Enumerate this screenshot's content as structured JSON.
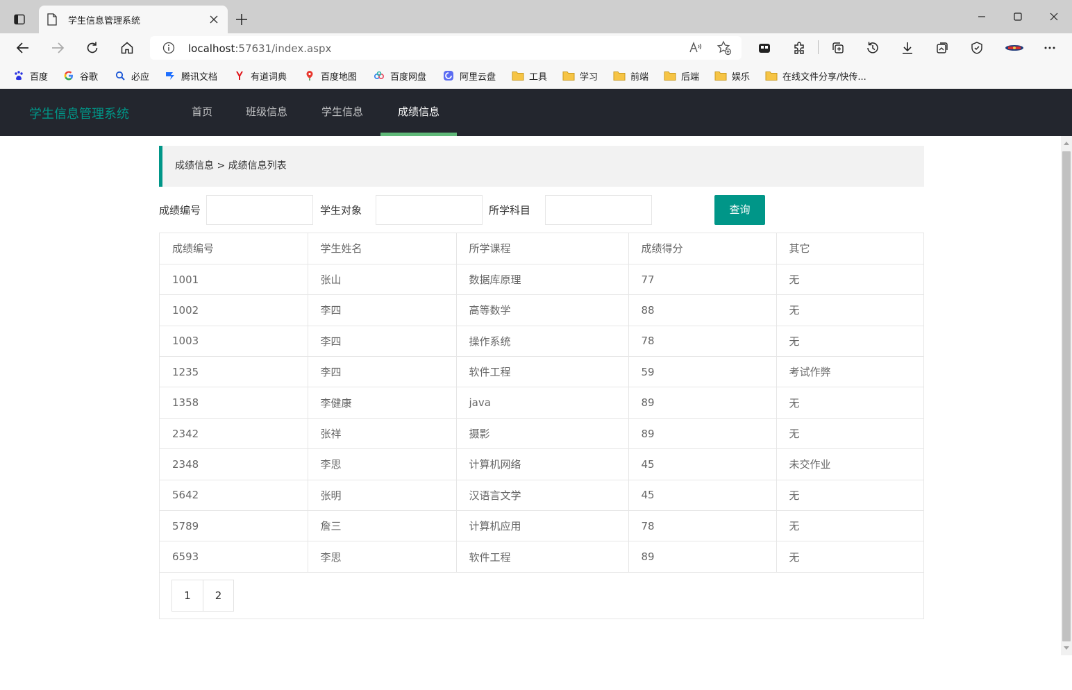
{
  "browser": {
    "tab_title": "学生信息管理系统",
    "url_host": "localhost",
    "url_rest": ":57631/index.aspx",
    "bookmarks": [
      {
        "label": "百度",
        "icon": "baidu-icon"
      },
      {
        "label": "谷歌",
        "icon": "google-icon"
      },
      {
        "label": "必应",
        "icon": "bing-icon"
      },
      {
        "label": "腾讯文档",
        "icon": "tencent-docs-icon"
      },
      {
        "label": "有道词典",
        "icon": "youdao-icon"
      },
      {
        "label": "百度地图",
        "icon": "map-pin-icon"
      },
      {
        "label": "百度网盘",
        "icon": "cloud-disk-icon"
      },
      {
        "label": "阿里云盘",
        "icon": "aliyun-icon"
      },
      {
        "label": "工具",
        "icon": "folder-icon"
      },
      {
        "label": "学习",
        "icon": "folder-icon"
      },
      {
        "label": "前端",
        "icon": "folder-icon"
      },
      {
        "label": "后端",
        "icon": "folder-icon"
      },
      {
        "label": "娱乐",
        "icon": "folder-icon"
      },
      {
        "label": "在线文件分享/快传...",
        "icon": "folder-icon"
      }
    ]
  },
  "app": {
    "brand": "学生信息管理系统",
    "nav": [
      "首页",
      "班级信息",
      "学生信息",
      "成绩信息"
    ],
    "active_nav": "成绩信息",
    "breadcrumb": "成绩信息 > 成绩信息列表",
    "search": {
      "label_id": "成绩编号",
      "label_student": "学生对象",
      "label_subject": "所学科目",
      "button": "查询"
    },
    "table": {
      "headers": [
        "成绩编号",
        "学生姓名",
        "所学课程",
        "成绩得分",
        "其它"
      ],
      "rows": [
        [
          "1001",
          "张山",
          "数据库原理",
          "77",
          "无"
        ],
        [
          "1002",
          "李四",
          "高等数学",
          "88",
          "无"
        ],
        [
          "1003",
          "李四",
          "操作系统",
          "78",
          "无"
        ],
        [
          "1235",
          "李四",
          "软件工程",
          "59",
          "考试作弊"
        ],
        [
          "1358",
          "李健康",
          "java",
          "89",
          "无"
        ],
        [
          "2342",
          "张祥",
          "摄影",
          "89",
          "无"
        ],
        [
          "2348",
          "李思",
          "计算机网络",
          "45",
          "未交作业"
        ],
        [
          "5642",
          "张明",
          "汉语言文学",
          "45",
          "无"
        ],
        [
          "5789",
          "詹三",
          "计算机应用",
          "78",
          "无"
        ],
        [
          "6593",
          "李思",
          "软件工程",
          "89",
          "无"
        ]
      ]
    },
    "pager": [
      "1",
      "2"
    ]
  },
  "colors": {
    "accent": "#009688",
    "nav_bg": "#23262e",
    "active_underline": "#5fb878"
  }
}
